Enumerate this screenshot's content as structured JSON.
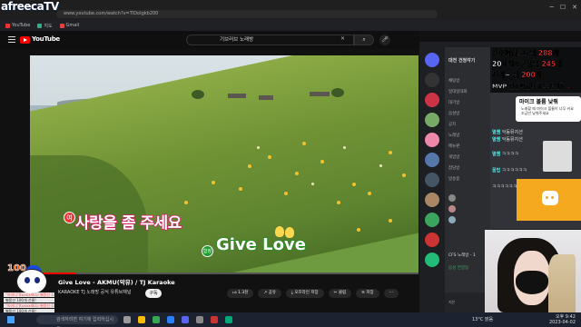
{
  "browser": {
    "url": "www.youtube.com/watch?v=TlDoIgkb200",
    "bookmarks": [
      "YouTube",
      "지도",
      "Gmail"
    ]
  },
  "overlay": {
    "brand": "afreecaTV"
  },
  "youtube": {
    "logo": "YouTube",
    "search_query": "기브러브 노래방",
    "video_title": "Give Love - AKMU(악뮤) / TJ Karaoke",
    "channel_name": "KARAOKE TJ 노래방 공식 유튜브채널",
    "subscribe_label": "구독",
    "like_count": "1.3천",
    "share_label": "공유",
    "offline_label": "오프라인 저장",
    "clip_label": "클립",
    "save_label": "저장",
    "progress_pct": 12
  },
  "lyrics": {
    "line1": "사랑을 좀 주세요",
    "line1_mark": "여",
    "line2": "Give Love",
    "line2_mark": "합창"
  },
  "mascot": {
    "badge": "100",
    "donations": [
      "\"아이디\"(tuxxx461) 별풍선 100개 선물!",
      "별풍선 100개 선물!",
      "\"아이디\"(tuxxx461) 별풍선 100개 선물!",
      "별풍선 100개 선물!"
    ]
  },
  "discord": {
    "server_header": "대전 건청각기",
    "channels": [
      "채팅방",
      "일대일대화",
      "대기방",
      "음성방",
      "공지",
      "노래방",
      "메뉴판",
      "게임방",
      "잡담방",
      "방송중"
    ],
    "voice_status": "음성 연결됨",
    "voice_user": "지은",
    "room_label": "CFS 노래방 - 1"
  },
  "donation_ticker": [
    {
      "text": "전준혁입니다님 ",
      "amount": "288개"
    },
    {
      "text": "20사회초년생님 ",
      "amount": "245개"
    },
    {
      "text": "사리~ 님 ",
      "amount": "200개"
    },
    {
      "text": "MVP 전준혁입니다 무한연장 ",
      "amount": "♪"
    }
  ],
  "chat": {
    "bubble_title": "마이크 볼륨 낮춰",
    "bubble_text": "노래할 때 마이크 볼륨이 너무 커요 조금만 낮춰주세요",
    "lines": [
      {
        "nick": "열쌤",
        "text": "악동뮤지션"
      },
      {
        "nick": "열쌤",
        "text": "악동뮤지션"
      },
      {
        "nick": "열쌤",
        "text": "ㅋㅋㅋㅋ"
      },
      {
        "nick": "꿀팁",
        "text": "ㅋㅋㅋㅋㅋㅋ"
      },
      {
        "nick": "",
        "text": "ㅋㅋㅋㅋㅋㅋㅋㅋ"
      }
    ]
  },
  "taskbar": {
    "search_placeholder": "검색하려면 여기에 입력하십시오.",
    "weather": "13°C 맑음",
    "time": "오후 9:42",
    "date": "2023-04-02"
  },
  "colors": {
    "yt_red": "#ff0000",
    "lyric_pink": "#d02060",
    "lyric_green": "#1e8a1e",
    "discord_card": "#f5a91e"
  }
}
